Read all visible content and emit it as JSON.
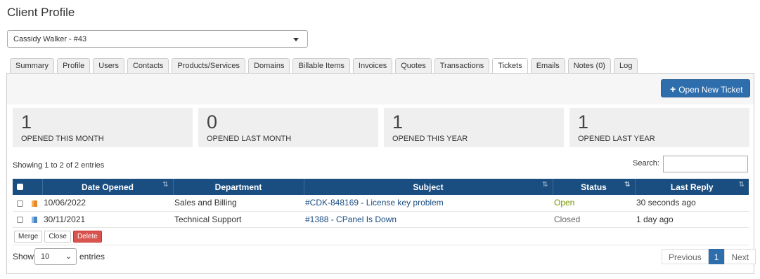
{
  "page": {
    "title": "Client Profile"
  },
  "client_select": {
    "value": "Cassidy Walker - #43"
  },
  "tabs": [
    {
      "label": "Summary",
      "active": false
    },
    {
      "label": "Profile",
      "active": false
    },
    {
      "label": "Users",
      "active": false
    },
    {
      "label": "Contacts",
      "active": false
    },
    {
      "label": "Products/Services",
      "active": false
    },
    {
      "label": "Domains",
      "active": false
    },
    {
      "label": "Billable Items",
      "active": false
    },
    {
      "label": "Invoices",
      "active": false
    },
    {
      "label": "Quotes",
      "active": false
    },
    {
      "label": "Transactions",
      "active": false
    },
    {
      "label": "Tickets",
      "active": true
    },
    {
      "label": "Emails",
      "active": false
    },
    {
      "label": "Notes (0)",
      "active": false
    },
    {
      "label": "Log",
      "active": false
    }
  ],
  "open_ticket_button": {
    "label": "Open New Ticket",
    "icon": "plus-icon"
  },
  "stats": [
    {
      "value": "1",
      "label": "OPENED THIS MONTH"
    },
    {
      "value": "0",
      "label": "OPENED LAST MONTH"
    },
    {
      "value": "1",
      "label": "OPENED THIS YEAR"
    },
    {
      "value": "1",
      "label": "OPENED LAST YEAR"
    }
  ],
  "table": {
    "showing": "Showing 1 to 2 of 2 entries",
    "search_label": "Search:",
    "search_value": "",
    "columns": [
      "Date Opened",
      "Department",
      "Subject",
      "Status",
      "Last Reply"
    ],
    "rows": [
      {
        "date": "10/06/2022",
        "department": "Sales and Billing",
        "subject": "#CDK-848169 - License key problem",
        "status": "Open",
        "last_reply": "30 seconds ago",
        "flag_color": "#e8862a"
      },
      {
        "date": "30/11/2021",
        "department": "Technical Support",
        "subject": "#1388 - CPanel Is Down",
        "status": "Closed",
        "last_reply": "1 day ago",
        "flag_color": "#4a86c5"
      }
    ]
  },
  "actions": {
    "merge": "Merge",
    "close": "Close",
    "delete": "Delete"
  },
  "length": {
    "show": "Show",
    "value": "10",
    "entries": "entries"
  },
  "pager": {
    "previous": "Previous",
    "current": "1",
    "next": "Next"
  },
  "colors": {
    "header": "#1a4d80",
    "primary": "#2f6ead",
    "danger": "#d9534f",
    "open_status": "#779500"
  }
}
